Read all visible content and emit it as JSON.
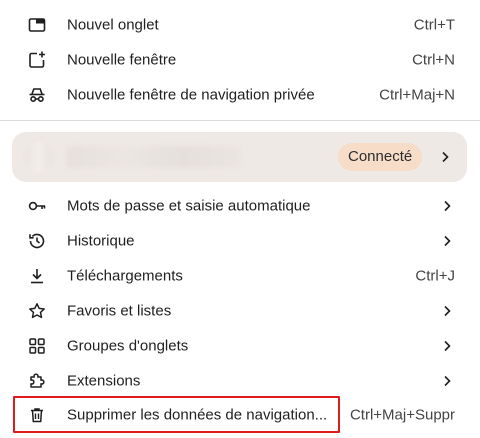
{
  "menu": {
    "items_top": [
      {
        "label": "Nouvel onglet",
        "shortcut": "Ctrl+T",
        "icon": "new-tab-icon"
      },
      {
        "label": "Nouvelle fenêtre",
        "shortcut": "Ctrl+N",
        "icon": "new-window-icon"
      },
      {
        "label": "Nouvelle fenêtre de navigation privée",
        "shortcut": "Ctrl+Maj+N",
        "icon": "incognito-icon"
      }
    ],
    "profile": {
      "status": "Connecté",
      "icon": "chevron-right-icon"
    },
    "items_bottom": [
      {
        "label": "Mots de passe et saisie automatique",
        "icon": "key-icon",
        "has_submenu": true
      },
      {
        "label": "Historique",
        "icon": "history-icon",
        "has_submenu": true
      },
      {
        "label": "Téléchargements",
        "shortcut": "Ctrl+J",
        "icon": "download-icon"
      },
      {
        "label": "Favoris et listes",
        "icon": "star-icon",
        "has_submenu": true
      },
      {
        "label": "Groupes d'onglets",
        "icon": "tab-groups-icon",
        "has_submenu": true
      },
      {
        "label": "Extensions",
        "icon": "extension-puzzle-icon",
        "has_submenu": true
      },
      {
        "label": "Supprimer les données de navigation...",
        "shortcut": "Ctrl+Maj+Suppr",
        "icon": "trash-icon"
      }
    ]
  },
  "colors": {
    "profile_bg": "#efe9e6",
    "badge_bg": "#f7dcc8",
    "highlight": "#e01b1b"
  }
}
